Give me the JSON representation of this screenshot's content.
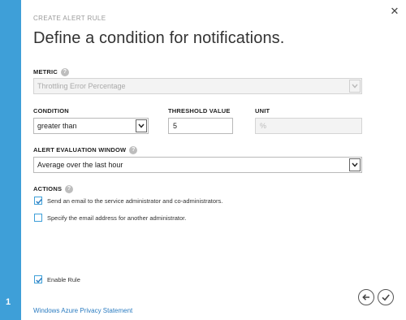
{
  "step": "1",
  "header": {
    "crumb": "CREATE ALERT RULE",
    "title": "Define a condition for notifications."
  },
  "metric": {
    "label": "METRIC",
    "value": "Throttling Error Percentage"
  },
  "condition": {
    "label": "CONDITION",
    "value": "greater than"
  },
  "threshold": {
    "label": "THRESHOLD VALUE",
    "value": "5"
  },
  "unit": {
    "label": "UNIT",
    "value": "%"
  },
  "window": {
    "label": "ALERT EVALUATION WINDOW",
    "value": "Average over the last hour"
  },
  "actions": {
    "label": "ACTIONS",
    "items": [
      {
        "label": "Send an email to the service administrator and co-administrators.",
        "checked": true
      },
      {
        "label": "Specify the email address for another administrator.",
        "checked": false
      }
    ]
  },
  "enable_rule": {
    "label": "Enable Rule",
    "checked": true
  },
  "footer": {
    "privacy_link": "Windows Azure Privacy Statement"
  },
  "colors": {
    "accent": "#3e9fd8",
    "link": "#2b7cc1"
  },
  "icons": {
    "close": "close-icon",
    "help": "help-icon",
    "back": "back-arrow-icon",
    "ok": "checkmark-icon"
  }
}
